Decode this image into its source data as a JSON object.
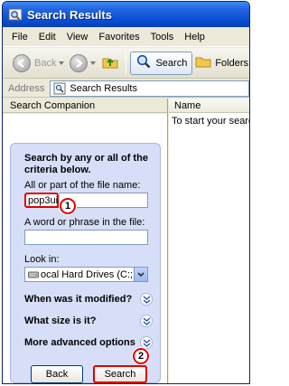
{
  "window": {
    "title": "Search Results"
  },
  "menu": [
    "File",
    "Edit",
    "View",
    "Favorites",
    "Tools",
    "Help"
  ],
  "toolbar": {
    "back_label": "Back",
    "search_label": "Search",
    "folders_label": "Folders"
  },
  "address": {
    "label": "Address",
    "value": "Search Results"
  },
  "left_pane": {
    "header": "Search Companion"
  },
  "right_pane": {
    "column_header": "Name",
    "message": "To start your search,"
  },
  "search_panel": {
    "title": "Search by any or all of the criteria below.",
    "filename_label": "All or part of the file name:",
    "filename_value": "pop3uidl",
    "phrase_label": "A word or phrase in the file:",
    "phrase_value": "",
    "lookin_label": "Look in:",
    "lookin_value": "ocal Hard Drives (C:;D:)",
    "expanders": [
      "When was it modified?",
      "What size is it?",
      "More advanced options"
    ],
    "back_button": "Back",
    "search_button": "Search"
  },
  "annotations": {
    "marker1": "1",
    "marker2": "2",
    "color": "#e00000"
  }
}
